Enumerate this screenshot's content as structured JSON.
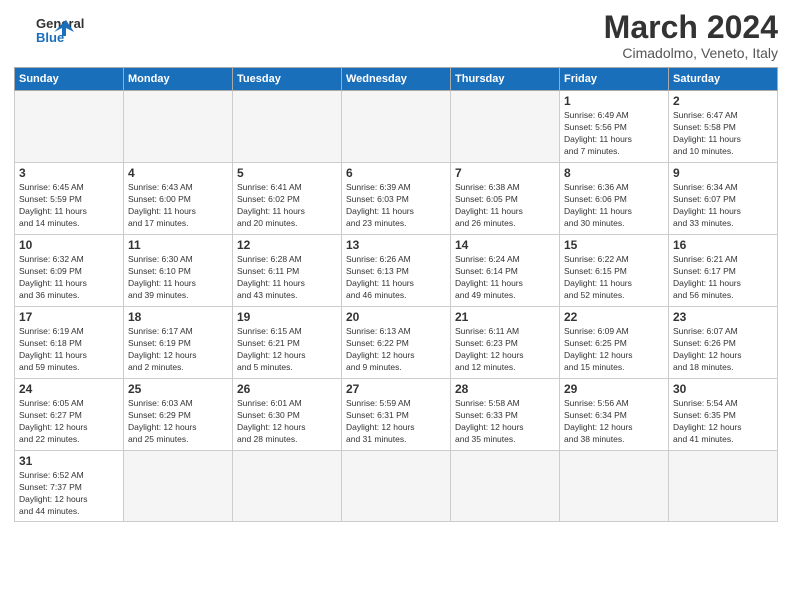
{
  "header": {
    "logo_general": "General",
    "logo_blue": "Blue",
    "title": "March 2024",
    "subtitle": "Cimadolmo, Veneto, Italy"
  },
  "weekdays": [
    "Sunday",
    "Monday",
    "Tuesday",
    "Wednesday",
    "Thursday",
    "Friday",
    "Saturday"
  ],
  "weeks": [
    [
      {
        "day": "",
        "info": ""
      },
      {
        "day": "",
        "info": ""
      },
      {
        "day": "",
        "info": ""
      },
      {
        "day": "",
        "info": ""
      },
      {
        "day": "",
        "info": ""
      },
      {
        "day": "1",
        "info": "Sunrise: 6:49 AM\nSunset: 5:56 PM\nDaylight: 11 hours\nand 7 minutes."
      },
      {
        "day": "2",
        "info": "Sunrise: 6:47 AM\nSunset: 5:58 PM\nDaylight: 11 hours\nand 10 minutes."
      }
    ],
    [
      {
        "day": "3",
        "info": "Sunrise: 6:45 AM\nSunset: 5:59 PM\nDaylight: 11 hours\nand 14 minutes."
      },
      {
        "day": "4",
        "info": "Sunrise: 6:43 AM\nSunset: 6:00 PM\nDaylight: 11 hours\nand 17 minutes."
      },
      {
        "day": "5",
        "info": "Sunrise: 6:41 AM\nSunset: 6:02 PM\nDaylight: 11 hours\nand 20 minutes."
      },
      {
        "day": "6",
        "info": "Sunrise: 6:39 AM\nSunset: 6:03 PM\nDaylight: 11 hours\nand 23 minutes."
      },
      {
        "day": "7",
        "info": "Sunrise: 6:38 AM\nSunset: 6:05 PM\nDaylight: 11 hours\nand 26 minutes."
      },
      {
        "day": "8",
        "info": "Sunrise: 6:36 AM\nSunset: 6:06 PM\nDaylight: 11 hours\nand 30 minutes."
      },
      {
        "day": "9",
        "info": "Sunrise: 6:34 AM\nSunset: 6:07 PM\nDaylight: 11 hours\nand 33 minutes."
      }
    ],
    [
      {
        "day": "10",
        "info": "Sunrise: 6:32 AM\nSunset: 6:09 PM\nDaylight: 11 hours\nand 36 minutes."
      },
      {
        "day": "11",
        "info": "Sunrise: 6:30 AM\nSunset: 6:10 PM\nDaylight: 11 hours\nand 39 minutes."
      },
      {
        "day": "12",
        "info": "Sunrise: 6:28 AM\nSunset: 6:11 PM\nDaylight: 11 hours\nand 43 minutes."
      },
      {
        "day": "13",
        "info": "Sunrise: 6:26 AM\nSunset: 6:13 PM\nDaylight: 11 hours\nand 46 minutes."
      },
      {
        "day": "14",
        "info": "Sunrise: 6:24 AM\nSunset: 6:14 PM\nDaylight: 11 hours\nand 49 minutes."
      },
      {
        "day": "15",
        "info": "Sunrise: 6:22 AM\nSunset: 6:15 PM\nDaylight: 11 hours\nand 52 minutes."
      },
      {
        "day": "16",
        "info": "Sunrise: 6:21 AM\nSunset: 6:17 PM\nDaylight: 11 hours\nand 56 minutes."
      }
    ],
    [
      {
        "day": "17",
        "info": "Sunrise: 6:19 AM\nSunset: 6:18 PM\nDaylight: 11 hours\nand 59 minutes."
      },
      {
        "day": "18",
        "info": "Sunrise: 6:17 AM\nSunset: 6:19 PM\nDaylight: 12 hours\nand 2 minutes."
      },
      {
        "day": "19",
        "info": "Sunrise: 6:15 AM\nSunset: 6:21 PM\nDaylight: 12 hours\nand 5 minutes."
      },
      {
        "day": "20",
        "info": "Sunrise: 6:13 AM\nSunset: 6:22 PM\nDaylight: 12 hours\nand 9 minutes."
      },
      {
        "day": "21",
        "info": "Sunrise: 6:11 AM\nSunset: 6:23 PM\nDaylight: 12 hours\nand 12 minutes."
      },
      {
        "day": "22",
        "info": "Sunrise: 6:09 AM\nSunset: 6:25 PM\nDaylight: 12 hours\nand 15 minutes."
      },
      {
        "day": "23",
        "info": "Sunrise: 6:07 AM\nSunset: 6:26 PM\nDaylight: 12 hours\nand 18 minutes."
      }
    ],
    [
      {
        "day": "24",
        "info": "Sunrise: 6:05 AM\nSunset: 6:27 PM\nDaylight: 12 hours\nand 22 minutes."
      },
      {
        "day": "25",
        "info": "Sunrise: 6:03 AM\nSunset: 6:29 PM\nDaylight: 12 hours\nand 25 minutes."
      },
      {
        "day": "26",
        "info": "Sunrise: 6:01 AM\nSunset: 6:30 PM\nDaylight: 12 hours\nand 28 minutes."
      },
      {
        "day": "27",
        "info": "Sunrise: 5:59 AM\nSunset: 6:31 PM\nDaylight: 12 hours\nand 31 minutes."
      },
      {
        "day": "28",
        "info": "Sunrise: 5:58 AM\nSunset: 6:33 PM\nDaylight: 12 hours\nand 35 minutes."
      },
      {
        "day": "29",
        "info": "Sunrise: 5:56 AM\nSunset: 6:34 PM\nDaylight: 12 hours\nand 38 minutes."
      },
      {
        "day": "30",
        "info": "Sunrise: 5:54 AM\nSunset: 6:35 PM\nDaylight: 12 hours\nand 41 minutes."
      }
    ],
    [
      {
        "day": "31",
        "info": "Sunrise: 6:52 AM\nSunset: 7:37 PM\nDaylight: 12 hours\nand 44 minutes."
      },
      {
        "day": "",
        "info": ""
      },
      {
        "day": "",
        "info": ""
      },
      {
        "day": "",
        "info": ""
      },
      {
        "day": "",
        "info": ""
      },
      {
        "day": "",
        "info": ""
      },
      {
        "day": "",
        "info": ""
      }
    ]
  ]
}
